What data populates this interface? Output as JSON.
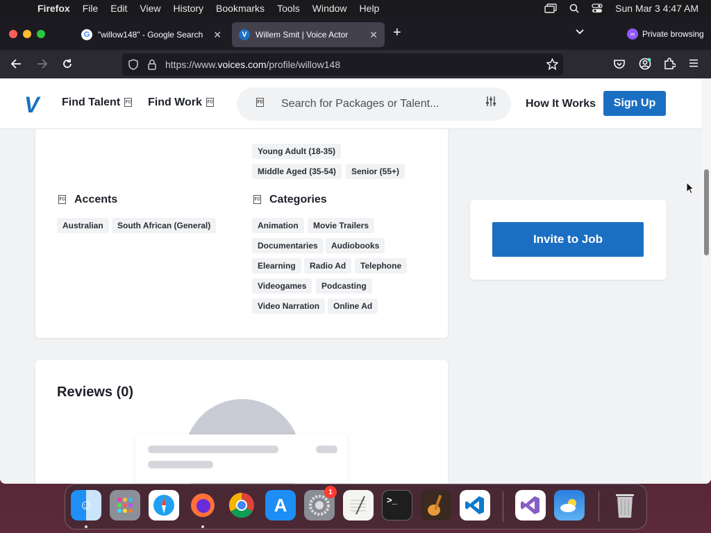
{
  "menubar": {
    "apple": "",
    "app": "Firefox",
    "items": [
      "File",
      "Edit",
      "View",
      "History",
      "Bookmarks",
      "Tools",
      "Window",
      "Help"
    ],
    "datetime": "Sun Mar 3  4:47 AM"
  },
  "tabs": [
    {
      "title": "\"willow148\" - Google Search",
      "favicon": "G"
    },
    {
      "title": "Willem Smit | Voice Actor",
      "favicon": "V"
    }
  ],
  "toolbar": {
    "private_label": "Private browsing",
    "url_prefix": "https://www.",
    "url_domain": "voices.com",
    "url_path": "/profile/willow148"
  },
  "header": {
    "logo": "V",
    "find_talent": "Find Talent",
    "find_work": "Find Work",
    "search_placeholder": "Search for Packages or Talent...",
    "how_it_works": "How It Works",
    "sign_up": "Sign Up"
  },
  "profile": {
    "ages": [
      "Young Adult (18-35)",
      "Middle Aged (35-54)",
      "Senior (55+)"
    ],
    "accents_title": "Accents",
    "accents": [
      "Australian",
      "South African (General)"
    ],
    "categories_title": "Categories",
    "categories": [
      "Animation",
      "Movie Trailers",
      "Documentaries",
      "Audiobooks",
      "Elearning",
      "Radio Ad",
      "Telephone",
      "Videogames",
      "Podcasting",
      "Video Narration",
      "Online Ad"
    ],
    "invite_button": "Invite to Job",
    "reviews_title": "Reviews (0)"
  },
  "dock": {
    "apps": [
      "finder",
      "launchpad",
      "safari",
      "firefox",
      "chrome",
      "app-store",
      "system-settings",
      "textedit",
      "terminal",
      "garageband",
      "vscode",
      "visual-studio",
      "weather",
      "trash"
    ],
    "settings_badge": "1"
  }
}
